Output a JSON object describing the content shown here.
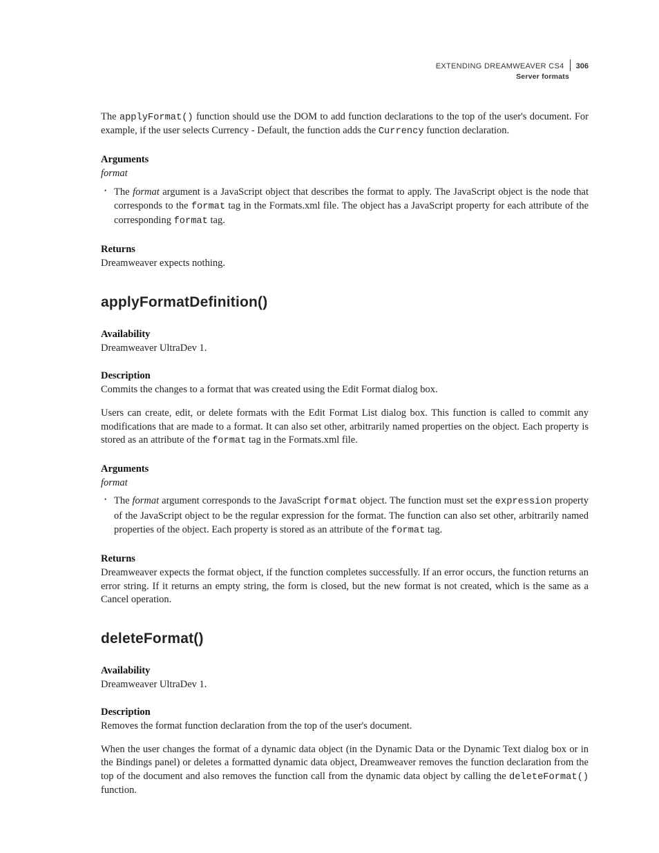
{
  "header": {
    "product": "EXTENDING DREAMWEAVER CS4",
    "pageNumber": "306",
    "section": "Server formats"
  },
  "intro": {
    "para1_pre": "The ",
    "para1_code": "applyFormat()",
    "para1_mid": " function should use the DOM to add function declarations to the top of the user's document. For example, if the user selects Currency - Default, the function adds the ",
    "para1_code2": "Currency",
    "para1_post": " function declaration."
  },
  "introArgs": {
    "heading": "Arguments",
    "argName": "format",
    "bullet_pre": "The ",
    "bullet_argItalic": "format",
    "bullet_mid": " argument is a JavaScript object that describes the format to apply. The JavaScript object is the node that corresponds to the ",
    "bullet_code1": "format",
    "bullet_mid2": " tag in the Formats.xml file. The object has a JavaScript property for each attribute of the corresponding ",
    "bullet_code2": "format",
    "bullet_post": " tag."
  },
  "introReturns": {
    "heading": "Returns",
    "text": "Dreamweaver expects nothing."
  },
  "fn1": {
    "title": "applyFormatDefinition()",
    "availHeading": "Availability",
    "availText": "Dreamweaver UltraDev 1.",
    "descHeading": "Description",
    "descP1": "Commits the changes to a format that was created using the Edit Format dialog box.",
    "descP2_pre": "Users can create, edit, or delete formats with the Edit Format List dialog box. This function is called to commit any modifications that are made to a format. It can also set other, arbitrarily named properties on the object. Each property is stored as an attribute of the ",
    "descP2_code": "format",
    "descP2_post": " tag in the Formats.xml file.",
    "argsHeading": "Arguments",
    "argName": "format",
    "bullet_pre": "The ",
    "bullet_argItalic": "format",
    "bullet_mid1": " argument corresponds to the JavaScript ",
    "bullet_code1": "format",
    "bullet_mid2": " object. The function must set the ",
    "bullet_code2": "expression",
    "bullet_mid3": " property of the JavaScript object to be the regular expression for the format. The function can also set other, arbitrarily named properties of the object. Each property is stored as an attribute of the ",
    "bullet_code3": "format",
    "bullet_post": " tag.",
    "returnsHeading": "Returns",
    "returnsText": "Dreamweaver expects the format object, if the function completes successfully. If an error occurs, the function returns an error string. If it returns an empty string, the form is closed, but the new format is not created, which is the same as a Cancel operation."
  },
  "fn2": {
    "title": "deleteFormat()",
    "availHeading": "Availability",
    "availText": "Dreamweaver UltraDev 1.",
    "descHeading": "Description",
    "descP1": "Removes the format function declaration from the top of the user's document.",
    "descP2_pre": "When the user changes the format of a dynamic data object (in the Dynamic Data or the Dynamic Text dialog box or in the Bindings panel) or deletes a formatted dynamic data object, Dreamweaver removes the function declaration from the top of the document and also removes the function call from the dynamic data object by calling the ",
    "descP2_code": "deleteFormat()",
    "descP2_post": " function."
  }
}
